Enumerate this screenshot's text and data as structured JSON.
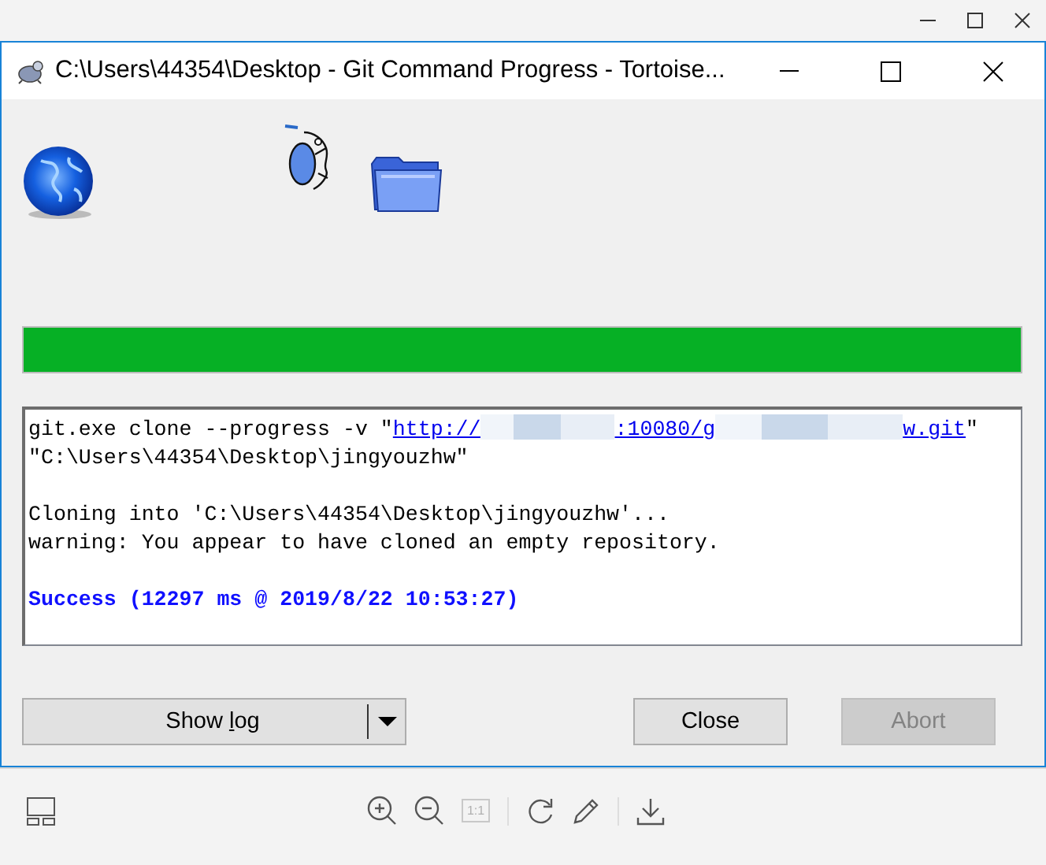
{
  "window": {
    "title": "C:\\Users\\44354\\Desktop - Git Command Progress - Tortoise..."
  },
  "progress": {
    "level": 1
  },
  "log": {
    "blocks": [
      [
        {
          "kind": "command",
          "segments": [
            {
              "kind": "text",
              "text": "git.exe clone --progress -v \""
            },
            {
              "kind": "link",
              "parts": [
                {
                  "kind": "text",
                  "text": "http://"
                },
                {
                  "kind": "redacted"
                },
                {
                  "kind": "text",
                  "text": ":10080/g"
                },
                {
                  "kind": "redacted"
                },
                {
                  "kind": "text",
                  "text": "w.git"
                }
              ]
            },
            {
              "kind": "text",
              "text": "\""
            }
          ]
        },
        {
          "kind": "plain",
          "text": "\"C:\\Users\\44354\\Desktop\\jingyouzhw\""
        }
      ],
      [
        {
          "kind": "plain",
          "text": "Cloning into 'C:\\Users\\44354\\Desktop\\jingyouzhw'..."
        },
        {
          "kind": "plain",
          "text": "warning: You appear to have cloned an empty repository."
        }
      ],
      [
        {
          "kind": "success",
          "text": "Success (12297 ms @ 2019/8/22 10:53:27)"
        }
      ]
    ]
  },
  "buttons": [
    {
      "kind": "split",
      "label": [
        {
          "text": "Show ",
          "underlined": false
        },
        {
          "text": "l",
          "underlined": true
        },
        {
          "text": "og",
          "underlined": false
        }
      ],
      "disabled": false
    },
    {
      "kind": "plain",
      "label": "Close",
      "disabled": false
    },
    {
      "kind": "plain",
      "label": "Abort",
      "disabled": true
    }
  ],
  "viewer_toolbar": {
    "actual_size": {
      "label": "1:1",
      "disabled": true
    }
  }
}
